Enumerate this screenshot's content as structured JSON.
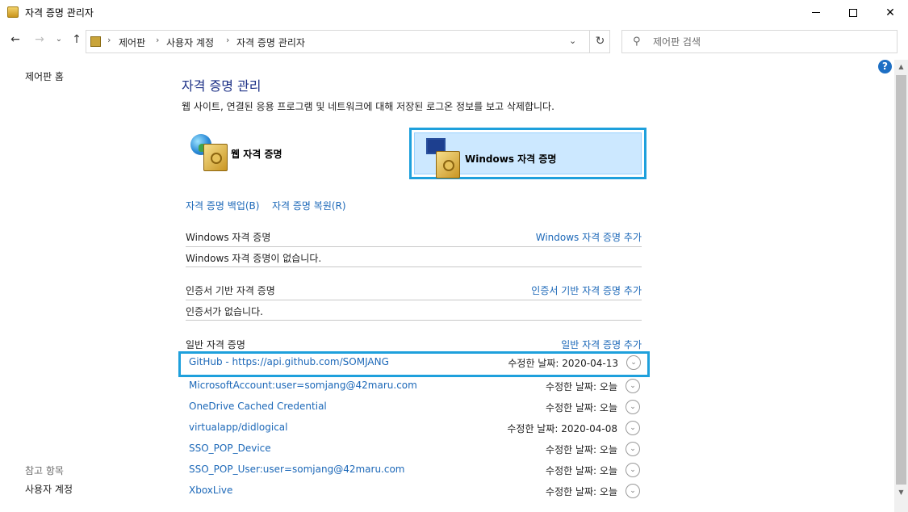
{
  "window": {
    "title": "자격 증명 관리자",
    "min": "minimize",
    "max": "maximize",
    "close": "✕"
  },
  "address": {
    "crumbs": [
      "제어판",
      "사용자 계정",
      "자격 증명 관리자"
    ],
    "search_placeholder": "제어판 검색"
  },
  "leftnav": {
    "home": "제어판 홈",
    "see_also": "참고 항목",
    "user_accounts": "사용자 계정"
  },
  "main": {
    "heading": "자격 증명 관리",
    "description": "웹 사이트, 연결된 응용 프로그램 및 네트워크에 대해 저장된 로그온 정보를 보고 삭제합니다.",
    "web_credentials_label": "웹 자격 증명",
    "windows_credentials_label": "Windows 자격 증명",
    "backup_link": "자격 증명 백업(B)",
    "restore_link": "자격 증명 복원(R)"
  },
  "sections": {
    "windows": {
      "title": "Windows 자격 증명",
      "add": "Windows 자격 증명 추가",
      "empty": "Windows 자격 증명이 없습니다."
    },
    "certificate": {
      "title": "인증서 기반 자격 증명",
      "add": "인증서 기반 자격 증명 추가",
      "empty": "인증서가 없습니다."
    },
    "generic": {
      "title": "일반 자격 증명",
      "add": "일반 자격 증명 추가",
      "items": [
        {
          "name": "GitHub - https://api.github.com/SOMJANG",
          "modified": "수정한 날짜:  2020-04-13"
        },
        {
          "name": "MicrosoftAccount:user=somjang@42maru.com",
          "modified": "수정한 날짜:  오늘"
        },
        {
          "name": "OneDrive Cached Credential",
          "modified": "수정한 날짜:  오늘"
        },
        {
          "name": "virtualapp/didlogical",
          "modified": "수정한 날짜:  2020-04-08"
        },
        {
          "name": "SSO_POP_Device",
          "modified": "수정한 날짜:  오늘"
        },
        {
          "name": "SSO_POP_User:user=somjang@42maru.com",
          "modified": "수정한 날짜:  오늘"
        },
        {
          "name": "XboxLive",
          "modified": "수정한 날짜:  오늘"
        }
      ]
    }
  },
  "colors": {
    "link": "#1c68b8",
    "heading": "#1e3287",
    "highlight_border": "#1ea0dc",
    "selected_fill": "#cce8ff"
  }
}
